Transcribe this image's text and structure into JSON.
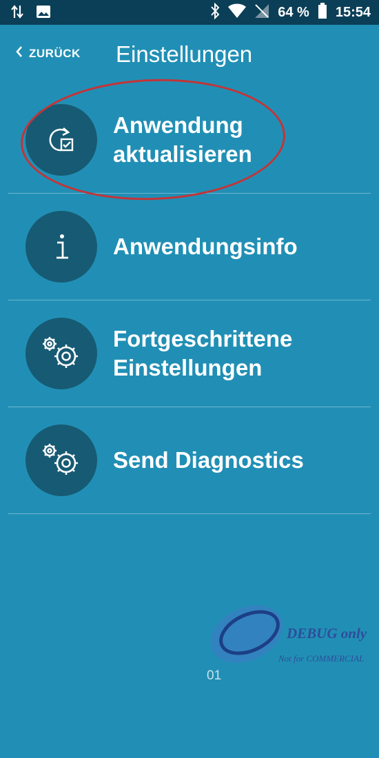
{
  "status_bar": {
    "battery": "64 %",
    "time": "15:54"
  },
  "header": {
    "back_label": "ZURÜCK",
    "title": "Einstellungen"
  },
  "items": [
    {
      "lines": [
        "Anwendung",
        "aktualisieren"
      ],
      "icon": "update-check-icon"
    },
    {
      "lines": [
        "Anwendungsinfo",
        ""
      ],
      "icon": "info-icon"
    },
    {
      "lines": [
        "Fortgeschrittene",
        "Einstellungen"
      ],
      "icon": "gears-icon"
    },
    {
      "lines": [
        "Send Diagnostics",
        ""
      ],
      "icon": "gears-icon"
    }
  ],
  "watermark": {
    "line1": "DEBUG only",
    "line2": "Not for COMMERCIAL"
  },
  "page_number": "01",
  "colors": {
    "background": "#218fb5",
    "status_bar": "#0b3f57",
    "icon_circle": "#175a73",
    "highlight_oval": "#c43437"
  }
}
